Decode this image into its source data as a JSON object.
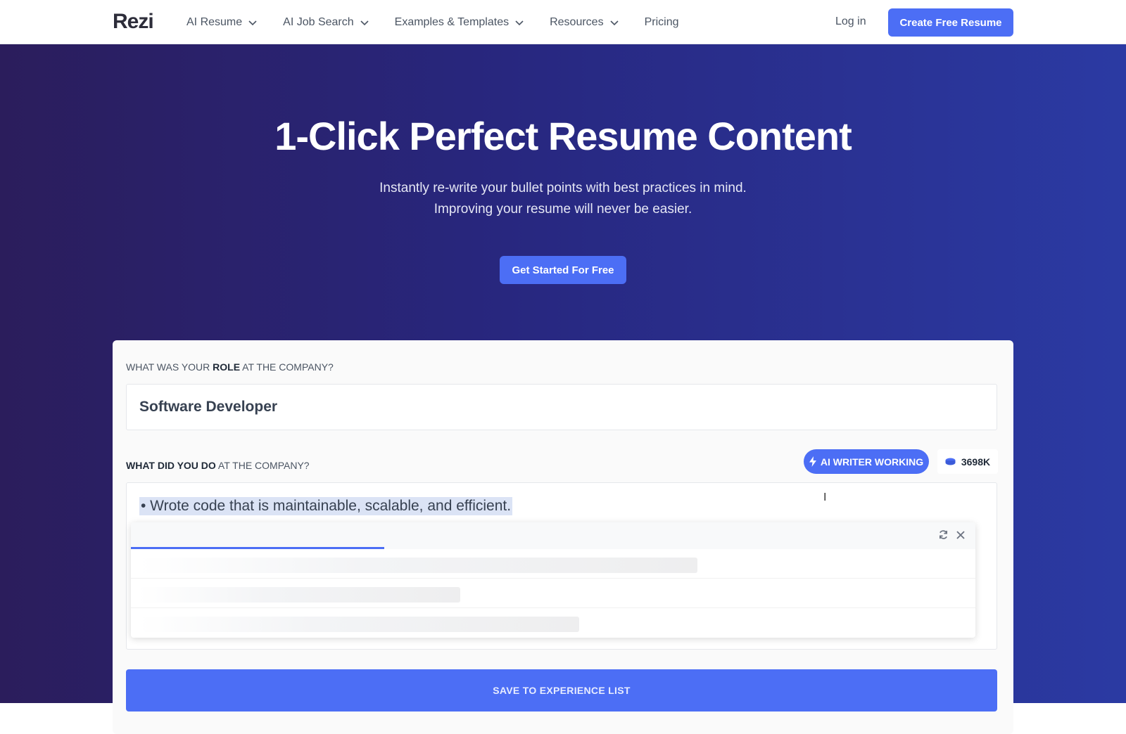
{
  "header": {
    "logo": "Rezi",
    "nav": [
      {
        "label": "AI Resume",
        "dropdown": true
      },
      {
        "label": "AI Job Search",
        "dropdown": true
      },
      {
        "label": "Examples & Templates",
        "dropdown": true
      },
      {
        "label": "Resources",
        "dropdown": true
      },
      {
        "label": "Pricing",
        "dropdown": false
      }
    ],
    "login_label": "Log in",
    "cta_label": "Create Free Resume"
  },
  "hero": {
    "title": "1-Click Perfect Resume Content",
    "subtitle_line1": "Instantly re-write your bullet points with best practices in mind.",
    "subtitle_line2": "Improving your resume will never be easier.",
    "cta_label": "Get Started For Free"
  },
  "form": {
    "role_label_pre": "WHAT WAS YOUR ",
    "role_label_bold": "ROLE",
    "role_label_post": " AT THE COMPANY?",
    "role_value": "Software Developer",
    "desc_label_bold": "WHAT DID YOU DO",
    "desc_label_post": " AT THE COMPANY?",
    "ai_badge_label": "AI WRITER WORKING",
    "token_count": "3698K",
    "bullet_text": "• Wrote code that is maintainable, scalable, and efficient.",
    "suggestions_progress": 0.3,
    "save_label": "SAVE TO EXPERIENCE LIST"
  },
  "colors": {
    "accent": "#4c6ef5",
    "hero_start": "#2b1d5c",
    "hero_end": "#2b3aa3"
  },
  "icons": [
    "chevron-down-icon",
    "lightning-icon",
    "coin-stack-icon",
    "refresh-icon",
    "close-icon",
    "text-cursor-icon"
  ]
}
